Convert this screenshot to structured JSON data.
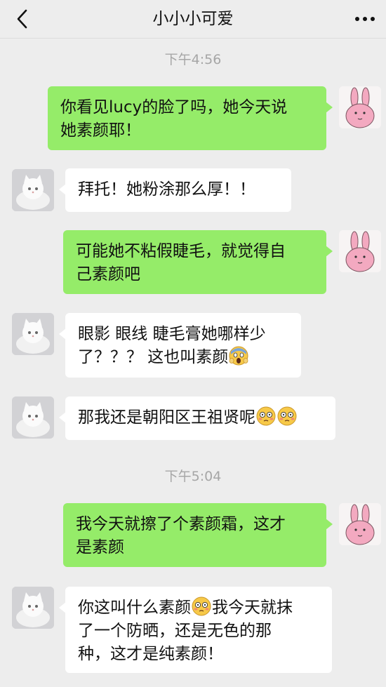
{
  "header": {
    "title": "小小小可爱",
    "back_icon": "chevron-left-icon",
    "more_icon": "more-dots-icon"
  },
  "timestamps": [
    "下午4:56",
    "下午5:04"
  ],
  "messages": [
    {
      "sender": "me",
      "lines": [
        "你看见lucy的脸了吗，她今天说",
        "她素颜耶！"
      ]
    },
    {
      "sender": "other",
      "lines": [
        "拜托！她粉涂那么厚！！"
      ]
    },
    {
      "sender": "me",
      "lines": [
        "可能她不粘假睫毛，就觉得自",
        "己素颜吧"
      ]
    },
    {
      "sender": "other",
      "lines": [
        "眼影 眼线 睫毛膏她哪样少",
        "了？？？ 这也叫素颜"
      ],
      "emoji": "screaming-face-emoji"
    },
    {
      "sender": "other",
      "lines": [
        "那我还是朝阳区王祖贤呢"
      ],
      "emoji": "flushed-face-emoji"
    },
    {
      "sender": "me",
      "lines": [
        "我今天就擦了个素颜霜，这才",
        "是素颜"
      ]
    },
    {
      "sender": "other",
      "lines": [
        "你这叫什么素颜",
        "我今天就抹",
        "了一个防晒，还是无色的那",
        "种，这才是纯素颜！"
      ],
      "emoji": "flushed-face-emoji"
    }
  ],
  "avatars": {
    "me": "pink-rabbit-avatar",
    "other": "white-cat-avatar"
  },
  "colors": {
    "background": "#ededed",
    "my_bubble": "#95ec69",
    "other_bubble": "#ffffff",
    "timestamp": "#a6a6a6"
  }
}
